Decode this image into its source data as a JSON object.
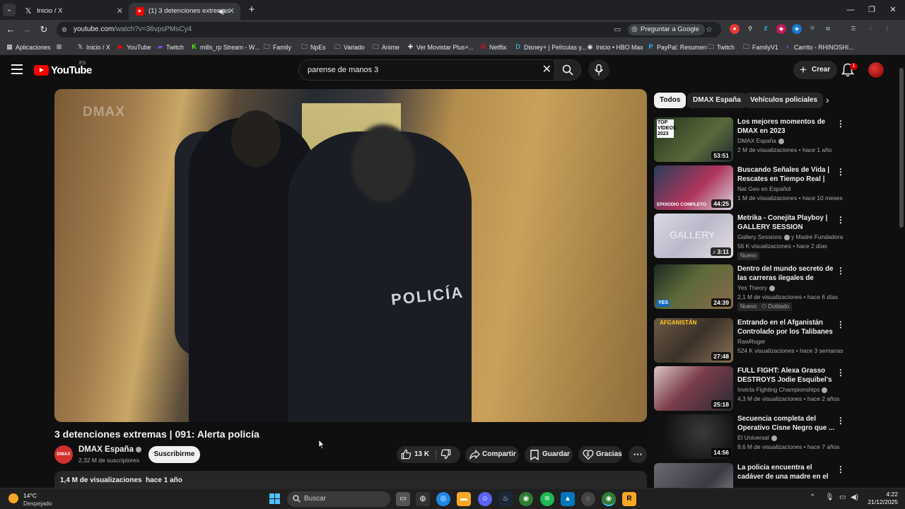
{
  "browser": {
    "tabs": [
      {
        "title": "Inicio / X",
        "icon": "x-logo-icon"
      },
      {
        "title": "(1) 3 detenciones extremas",
        "icon": "youtube-icon",
        "audio": true
      }
    ],
    "new_tab": "+",
    "url": {
      "host": "youtube.com",
      "path": "/watch?v=36vpsPMsCy4"
    },
    "ask_google": "Preguntar a Google",
    "bookmarks": [
      {
        "label": "Aplicaciones",
        "icon": "apps-grid-icon"
      },
      {
        "label": "Inicio / X",
        "icon": "x-logo-icon"
      },
      {
        "label": "YouTube",
        "icon": "youtube-icon"
      },
      {
        "label": "Twitch",
        "icon": "twitch-icon"
      },
      {
        "label": "mills_rp Stream - W...",
        "icon": "kick-icon"
      },
      {
        "label": "Family",
        "icon": "folder-icon"
      },
      {
        "label": "NpEs",
        "icon": "folder-icon"
      },
      {
        "label": "Variado",
        "icon": "folder-icon"
      },
      {
        "label": "Anime",
        "icon": "folder-icon"
      },
      {
        "label": "Ver Movistar Plus+...",
        "icon": "movistar-icon"
      },
      {
        "label": "Netflix",
        "icon": "netflix-icon"
      },
      {
        "label": "Disney+ | Películas y...",
        "icon": "disney-icon"
      },
      {
        "label": "Inicio • HBO Max",
        "icon": "hbo-icon"
      },
      {
        "label": "PayPal: Resumen",
        "icon": "paypal-icon"
      },
      {
        "label": "Twitch",
        "icon": "folder-icon"
      },
      {
        "label": "FamilyV1",
        "icon": "folder-icon"
      },
      {
        "label": "Carrito - RHINOSHI...",
        "icon": "shop-icon"
      }
    ]
  },
  "youtube": {
    "logo": "YouTube",
    "region": "ES",
    "search_query": "parense de manos 3",
    "create_label": "Crear",
    "notification_count": "1"
  },
  "video": {
    "watermark": "DMAX",
    "overlay_text": "POLICÍA",
    "title": "3 detenciones extremas | 091: Alerta policía",
    "channel": "DMAX España",
    "channel_avatar": "DMAX",
    "subscribers": "2,32 M de suscriptores",
    "subscribe_label": "Suscribirme",
    "likes": "13 K",
    "share_label": "Compartir",
    "save_label": "Guardar",
    "thanks_label": "Gracias",
    "views": "1,4 M de visualizaciones",
    "published": "hace 1 año"
  },
  "chips": [
    "Todos",
    "DMAX España",
    "Vehículos policiales"
  ],
  "recommendations": [
    {
      "title": "Los mejores momentos de DMAX en 2023",
      "channel": "DMAX España",
      "verified": true,
      "views": "2 M de visualizaciones",
      "age": "hace 1 año",
      "duration": "53:51",
      "thumb_text": "TOP VÍDEOS 2023",
      "thumb_color": "#3d4a2a"
    },
    {
      "title": "Buscando Señales de Vida | Rescates en Tiempo Real | Nat...",
      "channel": "Nat Geo en Español",
      "verified": false,
      "views": "1 M de visualizaciones",
      "age": "hace 10 meses",
      "duration": "44:25",
      "thumb_text": "EPISODIO COMPLETO",
      "thumb_color": "#8a2a4a"
    },
    {
      "title": "Metrika - Conejita Playboy | GALLERY SESSION",
      "channel": "Gallery Sessions",
      "verified": true,
      "views": "56 K visualizaciones",
      "age": "hace 2 días",
      "duration": "3:11",
      "badge": "Nuevo",
      "channel_extra": "y Madre Fundadora",
      "thumb_text": "GALLERY",
      "thumb_color": "#c9c9d6"
    },
    {
      "title": "Dentro del mundo secreto de las carreras ilegales de driftin...",
      "channel": "Yes Theory",
      "verified": true,
      "views": "2,1 M de visualizaciones",
      "age": "hace 6 días",
      "duration": "24:39",
      "badge": "Nuevo",
      "badge2": "Doblado",
      "thumb_text": "YES",
      "thumb_color": "#2f3a2a"
    },
    {
      "title": "Entrando en el Afganistán Controlado por los Talibanes",
      "channel": "RawRoger",
      "verified": false,
      "views": "524 K visualizaciones",
      "age": "hace 3 semanas",
      "duration": "27:48",
      "thumb_text": "AFGANISTÁN",
      "thumb_color": "#6b5a46"
    },
    {
      "title": "FULL FIGHT: Alexa Grasso DESTROYS Jodie Esquibel's ...",
      "channel": "Invicta Fighting Championships",
      "verified": true,
      "views": "4,3 M de visualizaciones",
      "age": "hace 2 años",
      "duration": "25:18",
      "thumb_text": "",
      "thumb_color": "#7a3c4a"
    },
    {
      "title": "Secuencia completa del Operativo Cisne Negro que ...",
      "channel": "El Universal",
      "verified": true,
      "views": "9,6 M de visualizaciones",
      "age": "hace 7 años",
      "duration": "14:56",
      "thumb_text": "",
      "thumb_color": "#2a2a2a"
    },
    {
      "title": "La policía encuentra el cadáver de una madre en el garaje de s...",
      "channel": "",
      "verified": false,
      "views": "",
      "age": "",
      "duration": "",
      "thumb_text": "",
      "thumb_color": "#4a4a52"
    }
  ],
  "taskbar": {
    "temperature": "14°C",
    "condition": "Despejado",
    "search_placeholder": "Buscar",
    "time": "4:22",
    "date": "21/12/2025"
  }
}
